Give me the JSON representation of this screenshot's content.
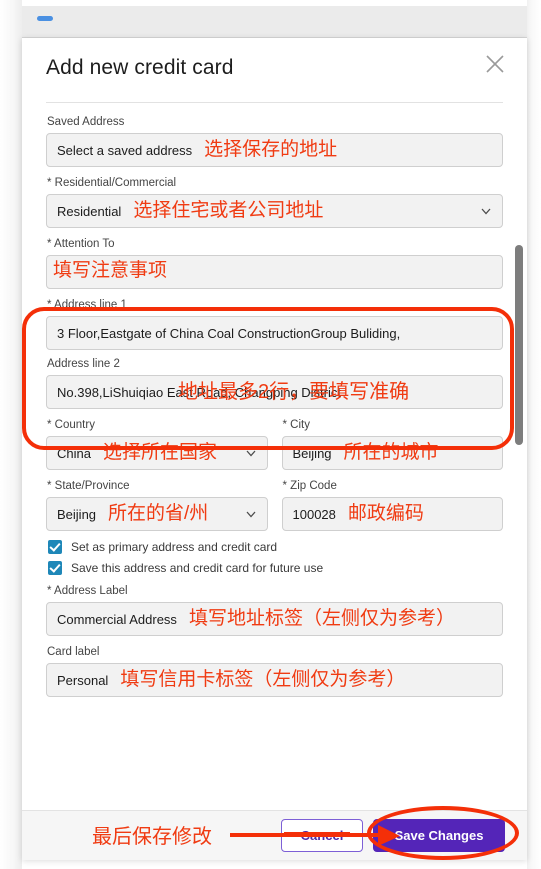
{
  "modal": {
    "title": "Add new credit card",
    "close_icon": "close-icon"
  },
  "fields": {
    "saved_address": {
      "label": "Saved Address",
      "value": "Select a saved address",
      "annotation": "选择保存的地址"
    },
    "residential_commercial": {
      "label": "Residential/Commercial",
      "value": "Residential",
      "annotation": "选择住宅或者公司地址",
      "chevron": "chevron-down-icon"
    },
    "attention_to": {
      "label": "Attention To",
      "value": "",
      "annotation": "填写注意事项"
    },
    "address_line_1": {
      "label": "Address line 1",
      "value": "3 Floor,Eastgate of China Coal ConstructionGroup Buliding,"
    },
    "address_line_2": {
      "label": "Address line 2",
      "value": "No.398,LiShuiqiao East Road, Changping District",
      "annotation": "地址最多2行，要填写准确"
    },
    "country": {
      "label": "Country",
      "value": "China",
      "annotation": "选择所在国家",
      "chevron": "chevron-down-icon"
    },
    "city": {
      "label": "City",
      "value": "Beijing",
      "annotation": "所在的城市"
    },
    "state_province": {
      "label": "State/Province",
      "value": "Beijing",
      "annotation": "所在的省/州",
      "chevron": "chevron-down-icon"
    },
    "zip_code": {
      "label": "Zip Code",
      "value": "100028",
      "annotation": "邮政编码"
    },
    "address_label": {
      "label": "Address Label",
      "value": "Commercial Address",
      "annotation": "填写地址标签（左侧仅为参考）"
    },
    "card_label": {
      "label": "Card label",
      "value": "Personal",
      "annotation": "填写信用卡标签（左侧仅为参考）"
    }
  },
  "checkboxes": [
    {
      "label": "Set as primary address and credit card",
      "checked": true
    },
    {
      "label": "Save this address and credit card for future use",
      "checked": true
    }
  ],
  "footer": {
    "cancel_label": "Cancel",
    "save_label": "Save Changes",
    "annotation": "最后保存修改"
  },
  "colors": {
    "annotation_red": "#f03b12",
    "highlight_red": "#f42f08",
    "primary_purple": "#5425b8",
    "checkbox_blue": "#1e87b8",
    "field_bg": "#f2f2f2",
    "field_border": "#cfcfcf"
  }
}
